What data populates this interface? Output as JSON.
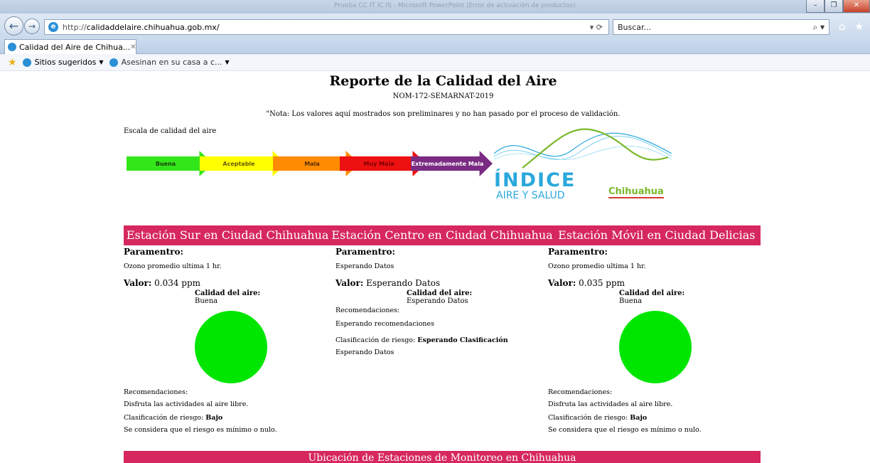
{
  "browser": {
    "window_title": "Prueba CC IT IC IS - Microsoft PowerPoint (Error de activación de productos)",
    "window_controls": {
      "minimize": "–",
      "restore": "❐",
      "close": "✕"
    },
    "address": {
      "url_prefix": "http://",
      "url_host": "calidaddelaire.chihuahua.gob.mx/",
      "refresh_label": "▾ ⟳"
    },
    "search": {
      "placeholder": "Buscar...",
      "icon": "search-icon"
    },
    "tab": {
      "label": "Calidad del Aire de Chihua...",
      "close": "✕"
    },
    "favorites": [
      {
        "label": "Sitios sugeridos",
        "caret": "▼"
      },
      {
        "label": "Asesinan en su casa a c...",
        "caret": "▼"
      }
    ]
  },
  "page": {
    "title": "Reporte de la Calidad del Aire",
    "subtitle": "NOM-172-SEMARNAT-2019",
    "note": "\"Nota: Los valores aquí mostrados son preliminares y no han pasado por el proceso de validación.",
    "scale_label": "Escala de calidad del aire",
    "scale": [
      {
        "label": "Buena",
        "color": "#33e61a",
        "text_color": "#1a3d10"
      },
      {
        "label": "Aceptable",
        "color": "#ffff00",
        "text_color": "#6b5a00"
      },
      {
        "label": "Mala",
        "color": "#ff8c00",
        "text_color": "#5a2a00"
      },
      {
        "label": "Muy Mala",
        "color": "#ee1111",
        "text_color": "#7a0000"
      },
      {
        "label": "Extremadamente Mala",
        "color": "#7a2b82",
        "text_color": "#ffffff"
      }
    ],
    "logo": {
      "line1": "ÍNDICE",
      "line2": "AIRE Y SALUD",
      "city": "Chihuahua"
    },
    "station_headers": [
      "Estación Sur en Ciudad Chihuahua",
      "Estación Centro en Ciudad Chihuahua",
      "Estación Móvil en Ciudad Delicias"
    ],
    "stations": [
      {
        "param_heading": "Paramentro:",
        "param": "Ozono promedio ultima 1 hr.",
        "valor_label": "Valor:",
        "valor": "0.034 ppm",
        "quality_title": "Calidad del aire:",
        "quality": "Buena",
        "color": "#00e600",
        "rec_label": "Recomendaciones:",
        "rec": "Disfruta las actividades al aire libre.",
        "risk_label": "Clasificación de riesgo:",
        "risk": "Bajo",
        "risk_desc": "Se considera que el riesgo es mínimo o nulo."
      },
      {
        "param_heading": "Paramentro:",
        "param": "Esperando Datos",
        "valor_label": "Valor:",
        "valor": "Esperando Datos",
        "quality_title": "Calidad del aire:",
        "quality": "Esperando Datos",
        "rec_label": "Recomendaciones:",
        "rec": "Esperando recomendaciones",
        "risk_label": "Clasificación de riesgo:",
        "risk": "Esperando Clasificación",
        "risk_desc": "Esperando Datos"
      },
      {
        "param_heading": "Paramentro:",
        "param": "Ozono promedio ultima 1 hr.",
        "valor_label": "Valor:",
        "valor": "0.035 ppm",
        "quality_title": "Calidad del aire:",
        "quality": "Buena",
        "color": "#00e600",
        "rec_label": "Recomendaciones:",
        "rec": "Disfruta las actividades al aire libre.",
        "risk_label": "Clasificación de riesgo:",
        "risk": "Bajo",
        "risk_desc": "Se considera que el riesgo es mínimo o nulo."
      }
    ],
    "footer_header": "Ubicación de Estaciones de Monitoreo en Chihuahua"
  }
}
